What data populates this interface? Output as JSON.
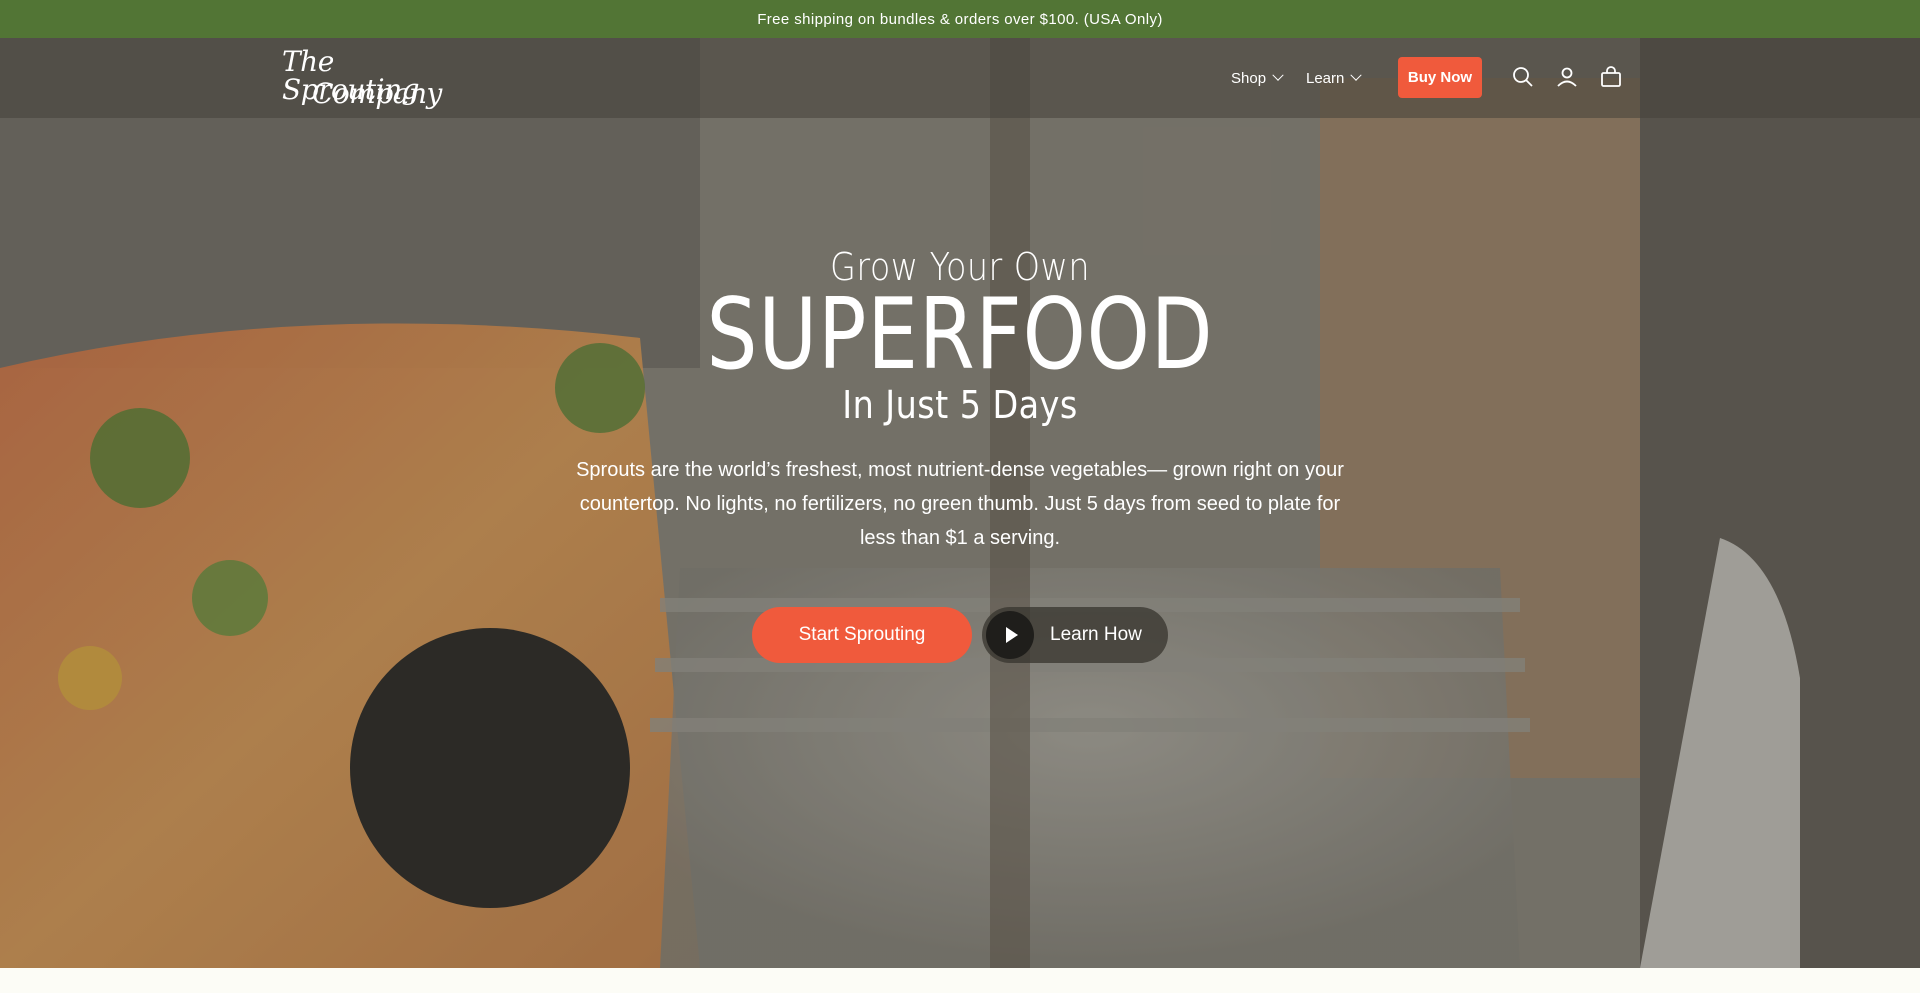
{
  "announcement": {
    "text": "Free shipping on bundles & orders over $100. (USA Only)"
  },
  "header": {
    "logo_line1": "The Sprouting",
    "logo_line2": "Company",
    "nav": [
      {
        "label": "Shop",
        "icon": "chevron-down-icon"
      },
      {
        "label": "Learn",
        "icon": "chevron-down-icon"
      }
    ],
    "buy_now": "Buy Now",
    "icons": [
      "search-icon",
      "account-icon",
      "cart-icon"
    ]
  },
  "hero": {
    "line1": "Grow Your Own",
    "line2": "SUPERFOOD",
    "line3": "In Just 5 Days",
    "description": "Sprouts are the world’s freshest, most nutrient-dense vegetables— grown right on your countertop. No lights, no fertilizers, no green thumb. Just 5 days from seed to plate for less than $1 a serving.",
    "cta_primary": "Start Sprouting",
    "cta_secondary": "Learn How",
    "cta_secondary_icon": "play-icon"
  },
  "colors": {
    "announcement_bg": "#527535",
    "accent": "#f05a3c",
    "text": "#ffffff"
  }
}
